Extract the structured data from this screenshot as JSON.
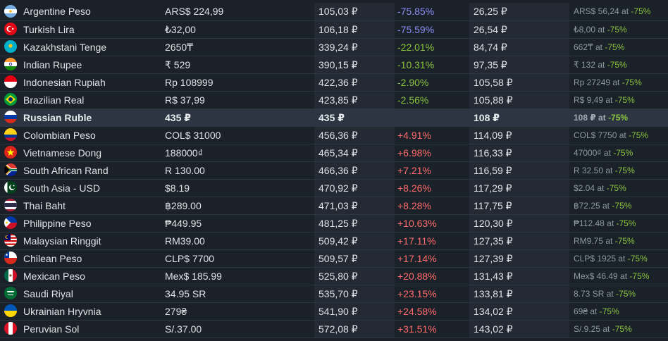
{
  "rows": [
    {
      "flag": "argentina-flag",
      "name": "Argentine Peso",
      "local": "ARS$ 224,99",
      "rub": "105,03 ₽",
      "diff": "-75.85%",
      "diff_tone": "neg",
      "sale": "26,25 ₽",
      "sale_local": "ARS$ 56,24 at",
      "sale_pct": "-75%"
    },
    {
      "flag": "turkey-flag",
      "name": "Turkish Lira",
      "local": "₺32,00",
      "rub": "106,18 ₽",
      "diff": "-75.59%",
      "diff_tone": "neg",
      "sale": "26,54 ₽",
      "sale_local": "₺8,00 at",
      "sale_pct": "-75%"
    },
    {
      "flag": "kazakhstan-flag",
      "name": "Kazakhstani Tenge",
      "local": "2650₸",
      "rub": "339,24 ₽",
      "diff": "-22.01%",
      "diff_tone": "neg-g",
      "sale": "84,74 ₽",
      "sale_local": "662₸ at",
      "sale_pct": "-75%"
    },
    {
      "flag": "india-flag",
      "name": "Indian Rupee",
      "local": "₹ 529",
      "rub": "390,15 ₽",
      "diff": "-10.31%",
      "diff_tone": "neg-g",
      "sale": "97,35 ₽",
      "sale_local": "₹ 132 at",
      "sale_pct": "-75%"
    },
    {
      "flag": "indonesia-flag",
      "name": "Indonesian Rupiah",
      "local": "Rp 108999",
      "rub": "422,36 ₽",
      "diff": "-2.90%",
      "diff_tone": "neg-g",
      "sale": "105,58 ₽",
      "sale_local": "Rp 27249 at",
      "sale_pct": "-75%"
    },
    {
      "flag": "brazil-flag",
      "name": "Brazilian Real",
      "local": "R$ 37,99",
      "rub": "423,85 ₽",
      "diff": "-2.56%",
      "diff_tone": "neg-g",
      "sale": "105,88 ₽",
      "sale_local": "R$ 9,49 at",
      "sale_pct": "-75%"
    },
    {
      "flag": "russia-flag",
      "name": "Russian Ruble",
      "local": "435 ₽",
      "rub": "435 ₽",
      "diff": "",
      "diff_tone": "",
      "sale": "108 ₽",
      "sale_local": "108 ₽ at",
      "sale_pct": "-75%",
      "highlight": true
    },
    {
      "flag": "colombia-flag",
      "name": "Colombian Peso",
      "local": "COL$ 31000",
      "rub": "456,36 ₽",
      "diff": "+4.91%",
      "diff_tone": "pos",
      "sale": "114,09 ₽",
      "sale_local": "COL$ 7750 at",
      "sale_pct": "-75%"
    },
    {
      "flag": "vietnam-flag",
      "name": "Vietnamese Dong",
      "local": "188000₫",
      "rub": "465,34 ₽",
      "diff": "+6.98%",
      "diff_tone": "pos",
      "sale": "116,33 ₽",
      "sale_local": "47000₫ at",
      "sale_pct": "-75%"
    },
    {
      "flag": "south-africa-flag",
      "name": "South African Rand",
      "local": "R 130.00",
      "rub": "466,36 ₽",
      "diff": "+7.21%",
      "diff_tone": "pos",
      "sale": "116,59 ₽",
      "sale_local": "R 32.50 at",
      "sale_pct": "-75%"
    },
    {
      "flag": "pakistan-flag",
      "name": "South Asia - USD",
      "local": "$8.19",
      "rub": "470,92 ₽",
      "diff": "+8.26%",
      "diff_tone": "pos",
      "sale": "117,29 ₽",
      "sale_local": "$2.04 at",
      "sale_pct": "-75%"
    },
    {
      "flag": "thailand-flag",
      "name": "Thai Baht",
      "local": "฿289.00",
      "rub": "471,03 ₽",
      "diff": "+8.28%",
      "diff_tone": "pos",
      "sale": "117,75 ₽",
      "sale_local": "฿72.25 at",
      "sale_pct": "-75%"
    },
    {
      "flag": "philippines-flag",
      "name": "Philippine Peso",
      "local": "₱449.95",
      "rub": "481,25 ₽",
      "diff": "+10.63%",
      "diff_tone": "pos",
      "sale": "120,30 ₽",
      "sale_local": "₱112.48 at",
      "sale_pct": "-75%"
    },
    {
      "flag": "malaysia-flag",
      "name": "Malaysian Ringgit",
      "local": "RM39.00",
      "rub": "509,42 ₽",
      "diff": "+17.11%",
      "diff_tone": "pos",
      "sale": "127,35 ₽",
      "sale_local": "RM9.75 at",
      "sale_pct": "-75%"
    },
    {
      "flag": "chile-flag",
      "name": "Chilean Peso",
      "local": "CLP$ 7700",
      "rub": "509,57 ₽",
      "diff": "+17.14%",
      "diff_tone": "pos",
      "sale": "127,39 ₽",
      "sale_local": "CLP$ 1925 at",
      "sale_pct": "-75%"
    },
    {
      "flag": "mexico-flag",
      "name": "Mexican Peso",
      "local": "Mex$ 185.99",
      "rub": "525,80 ₽",
      "diff": "+20.88%",
      "diff_tone": "pos",
      "sale": "131,43 ₽",
      "sale_local": "Mex$ 46.49 at",
      "sale_pct": "-75%"
    },
    {
      "flag": "saudi-arabia-flag",
      "name": "Saudi Riyal",
      "local": "34.95 SR",
      "rub": "535,70 ₽",
      "diff": "+23.15%",
      "diff_tone": "pos",
      "sale": "133,81 ₽",
      "sale_local": "8.73 SR at",
      "sale_pct": "-75%"
    },
    {
      "flag": "ukraine-flag",
      "name": "Ukrainian Hryvnia",
      "local": "279₴",
      "rub": "541,90 ₽",
      "diff": "+24.58%",
      "diff_tone": "pos",
      "sale": "134,02 ₽",
      "sale_local": "69₴ at",
      "sale_pct": "-75%"
    },
    {
      "flag": "peru-flag",
      "name": "Peruvian Sol",
      "local": "S/.37.00",
      "rub": "572,08 ₽",
      "diff": "+31.51%",
      "diff_tone": "pos",
      "sale": "143,02 ₽",
      "sale_local": "S/.9.25 at",
      "sale_pct": "-75%"
    }
  ]
}
